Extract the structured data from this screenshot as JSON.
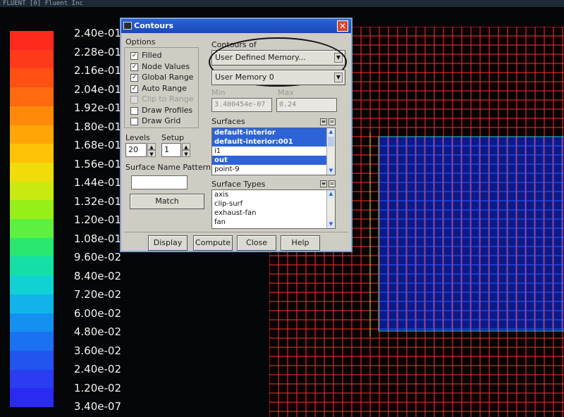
{
  "app_title": "FLUENT [0] Fluent Inc",
  "colorbar": {
    "labels": [
      "2.40e-01",
      "2.28e-01",
      "2.16e-01",
      "2.04e-01",
      "1.92e-01",
      "1.80e-01",
      "1.68e-01",
      "1.56e-01",
      "1.44e-01",
      "1.32e-01",
      "1.20e-01",
      "1.08e-01",
      "9.60e-02",
      "8.40e-02",
      "7.20e-02",
      "6.00e-02",
      "4.80e-02",
      "3.60e-02",
      "2.40e-02",
      "1.20e-02",
      "3.40e-07"
    ],
    "colors": [
      "#ff2a1e",
      "#ff3a1a",
      "#ff5014",
      "#ff6a10",
      "#ff8a0a",
      "#ffa606",
      "#ffc204",
      "#f0dc08",
      "#c8ea10",
      "#96f018",
      "#5ef040",
      "#28e870",
      "#14e0a6",
      "#10d2d2",
      "#10b4ea",
      "#1490f0",
      "#1c70f2",
      "#2255f0",
      "#2a3df0",
      "#2a2af0"
    ]
  },
  "dialog": {
    "title": "Contours",
    "options_label": "Options",
    "options": [
      {
        "label": "Filled",
        "checked": true,
        "enabled": true
      },
      {
        "label": "Node Values",
        "checked": true,
        "enabled": true
      },
      {
        "label": "Global Range",
        "checked": true,
        "enabled": true
      },
      {
        "label": "Auto Range",
        "checked": true,
        "enabled": true
      },
      {
        "label": "Clip to Range",
        "checked": false,
        "enabled": false
      },
      {
        "label": "Draw Profiles",
        "checked": false,
        "enabled": true
      },
      {
        "label": "Draw Grid",
        "checked": false,
        "enabled": true
      }
    ],
    "contours_of_label": "Contours of",
    "contours_of_value": "User Defined Memory...",
    "contours_sub_value": "User Memory 0",
    "min_label": "Min",
    "max_label": "Max",
    "min_value": "3.400454e-07",
    "max_value": "0.24",
    "levels_label": "Levels",
    "levels_value": "20",
    "setup_label": "Setup",
    "setup_value": "1",
    "surface_name_pattern_label": "Surface Name Pattern",
    "surface_name_pattern_value": "",
    "match_button": "Match",
    "surfaces_label": "Surfaces",
    "surfaces": [
      {
        "name": "default-interior",
        "selected": true
      },
      {
        "name": "default-interior:001",
        "selected": true
      },
      {
        "name": "i1",
        "selected": false
      },
      {
        "name": "out",
        "selected": true
      },
      {
        "name": "point-9",
        "selected": false
      }
    ],
    "surface_types_label": "Surface Types",
    "surface_types": [
      "axis",
      "clip-surf",
      "exhaust-fan",
      "fan"
    ],
    "buttons": {
      "display": "Display",
      "compute": "Compute",
      "close": "Close",
      "help": "Help"
    },
    "close_icon_glyph": "✕",
    "select_all_glyph": "≡",
    "deselect_glyph": "="
  }
}
